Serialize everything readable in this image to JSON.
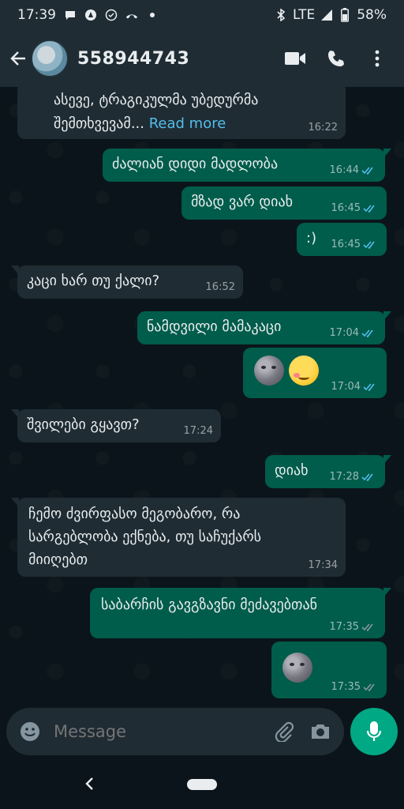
{
  "status_bar": {
    "time": "17:39",
    "network": "LTE",
    "battery": "58%"
  },
  "app_bar": {
    "contact_name": "558944743",
    "icons": [
      "back-arrow-icon",
      "video-call-icon",
      "phone-icon",
      "more-vert-icon"
    ]
  },
  "messages": [
    {
      "dir": "in",
      "text": "ასევე, ტრაგიკულმა უბედურმა\nშემთხვევამ...",
      "read_more": "Read more",
      "time": "16:22"
    },
    {
      "dir": "out",
      "text": "ძალიან დიდი მადლობა",
      "time": "16:44",
      "status": "read"
    },
    {
      "dir": "out",
      "text": "მზად ვარ დიახ",
      "time": "16:45",
      "status": "read"
    },
    {
      "dir": "out",
      "text": ":)",
      "time": "16:45",
      "status": "read"
    },
    {
      "dir": "in",
      "text": "კაცი ხარ თუ ქალი?",
      "time": "16:52"
    },
    {
      "dir": "out",
      "text": "ნამდვილი მამაკაცი",
      "time": "17:04",
      "status": "read"
    },
    {
      "dir": "out",
      "emojis": [
        "new-moon-face",
        "woozy-face"
      ],
      "time": "17:04",
      "status": "read"
    },
    {
      "dir": "in",
      "text": "შვილები გყავთ?",
      "time": "17:24"
    },
    {
      "dir": "out",
      "text": "დიახ",
      "time": "17:28",
      "status": "read"
    },
    {
      "dir": "in",
      "text": "ჩემო ძვირფასო მეგობარო, რა\nსარგებლობა ექნება, თუ საჩუქარს\nმიიღებთ",
      "time": "17:34"
    },
    {
      "dir": "out",
      "text": "საბარჩის გავგზავნი მეძავებთან",
      "time": "17:35",
      "status": "delivered"
    },
    {
      "dir": "out",
      "emojis": [
        "new-moon-face"
      ],
      "time": "17:35",
      "status": "delivered"
    }
  ],
  "composer": {
    "placeholder": "Message",
    "icons": [
      "emoji-icon",
      "attach-icon",
      "camera-icon",
      "mic-icon"
    ]
  },
  "colors": {
    "incoming_bubble": "#1f2c34",
    "outgoing_bubble": "#005c4b",
    "read_ticks": "#53bdeb",
    "accent": "#00a884"
  }
}
